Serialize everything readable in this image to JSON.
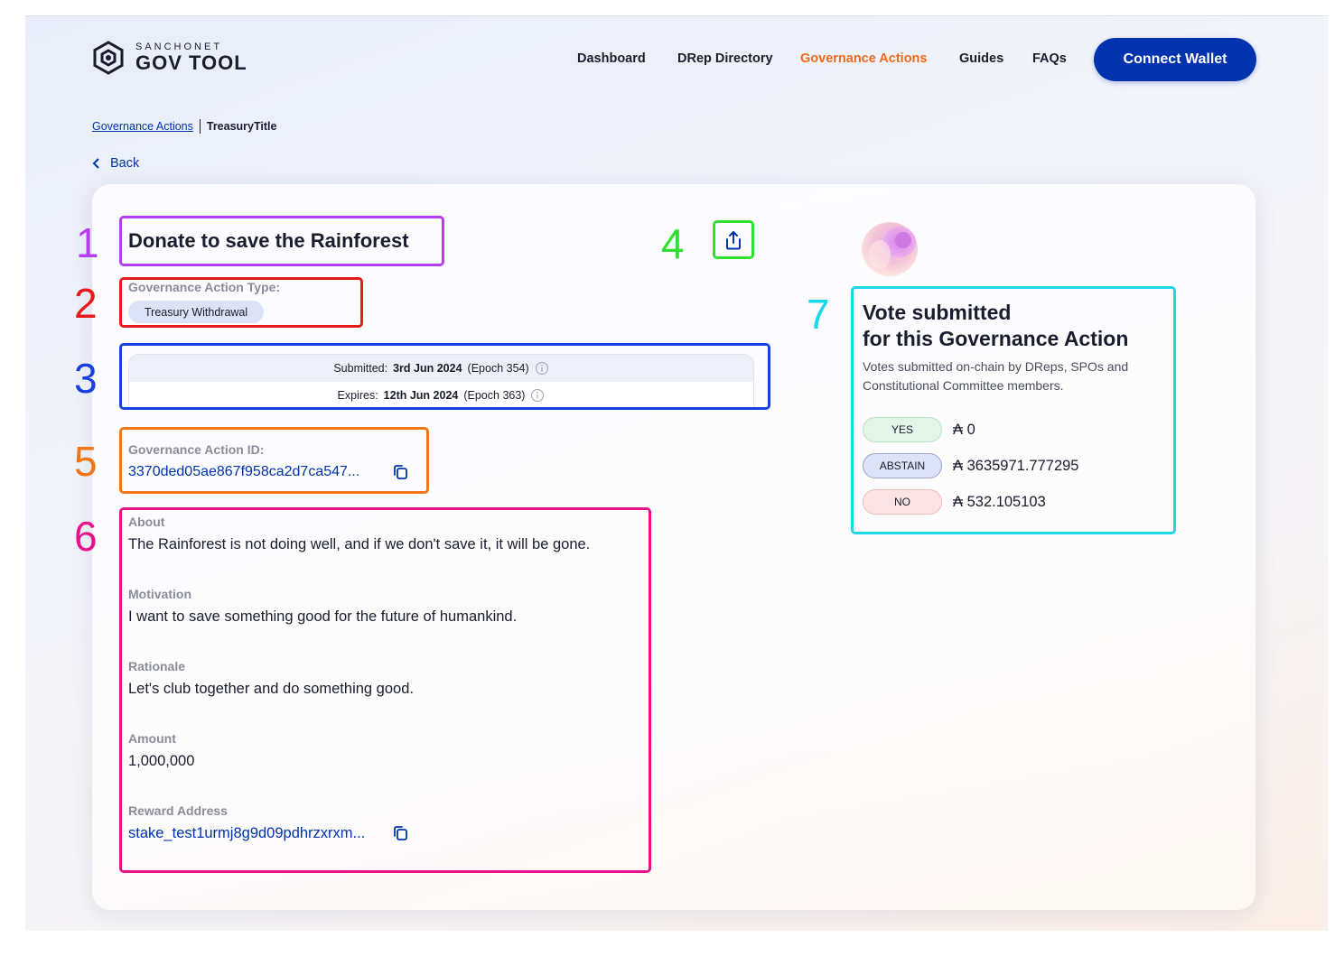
{
  "app": {
    "logo_small": "SANCHONET",
    "logo_big": "GOV TOOL"
  },
  "nav": {
    "items": [
      {
        "label": "Dashboard",
        "active": false
      },
      {
        "label": "DRep Directory",
        "active": false
      },
      {
        "label": "Governance Actions",
        "active": true
      },
      {
        "label": "Guides",
        "active": false
      },
      {
        "label": "FAQs",
        "active": false
      }
    ],
    "connect_label": "Connect Wallet",
    "active_color": "#ee6b1a",
    "brand_color": "#0033ad"
  },
  "breadcrumb": {
    "link": "Governance Actions",
    "current": "TreasuryTitle"
  },
  "back_label": "Back",
  "action": {
    "title": "Donate to save the Rainforest",
    "type_label": "Governance Action Type:",
    "type_value": "Treasury Withdrawal",
    "submitted_prefix": "Submitted:",
    "submitted_date": "3rd Jun 2024",
    "submitted_epoch": "(Epoch 354)",
    "expires_prefix": "Expires:",
    "expires_date": "12th Jun 2024",
    "expires_epoch": "(Epoch 363)",
    "id_label": "Governance Action ID:",
    "id_value": "3370ded05ae867f958ca2d7ca547...",
    "sections": [
      {
        "label": "About",
        "value": "The Rainforest is not doing well, and if we don't save it, it will be gone."
      },
      {
        "label": "Motivation",
        "value": "I want to save something good for the future of humankind."
      },
      {
        "label": "Rationale",
        "value": "Let's club together and do something good."
      },
      {
        "label": "Amount",
        "value": "1,000,000"
      }
    ],
    "reward_label": "Reward Address",
    "reward_value": "stake_test1urmj8g9d09pdhrzxrxm..."
  },
  "votes": {
    "title_line1": "Vote submitted",
    "title_line2": "for this Governance Action",
    "description": "Votes submitted on-chain by DReps, SPOs and Constitutional Committee members.",
    "rows": [
      {
        "label": "YES",
        "value": "₳ 0",
        "color": "#e2f5e6",
        "border": "#b7e3c2"
      },
      {
        "label": "ABSTAIN",
        "value": "₳ 3635971.777295",
        "color": "#dde3f6",
        "border": "#9aa6cf"
      },
      {
        "label": "NO",
        "value": "₳ 532.105103",
        "color": "#fde4e4",
        "border": "#f1b9b9"
      }
    ]
  },
  "annotations": [
    {
      "num": "1",
      "color": "#b53df2"
    },
    {
      "num": "2",
      "color": "#e81a1a"
    },
    {
      "num": "3",
      "color": "#1640e0"
    },
    {
      "num": "4",
      "color": "#2ee02e"
    },
    {
      "num": "5",
      "color": "#f27518"
    },
    {
      "num": "6",
      "color": "#e8128c"
    },
    {
      "num": "7",
      "color": "#1ad8ea"
    }
  ]
}
